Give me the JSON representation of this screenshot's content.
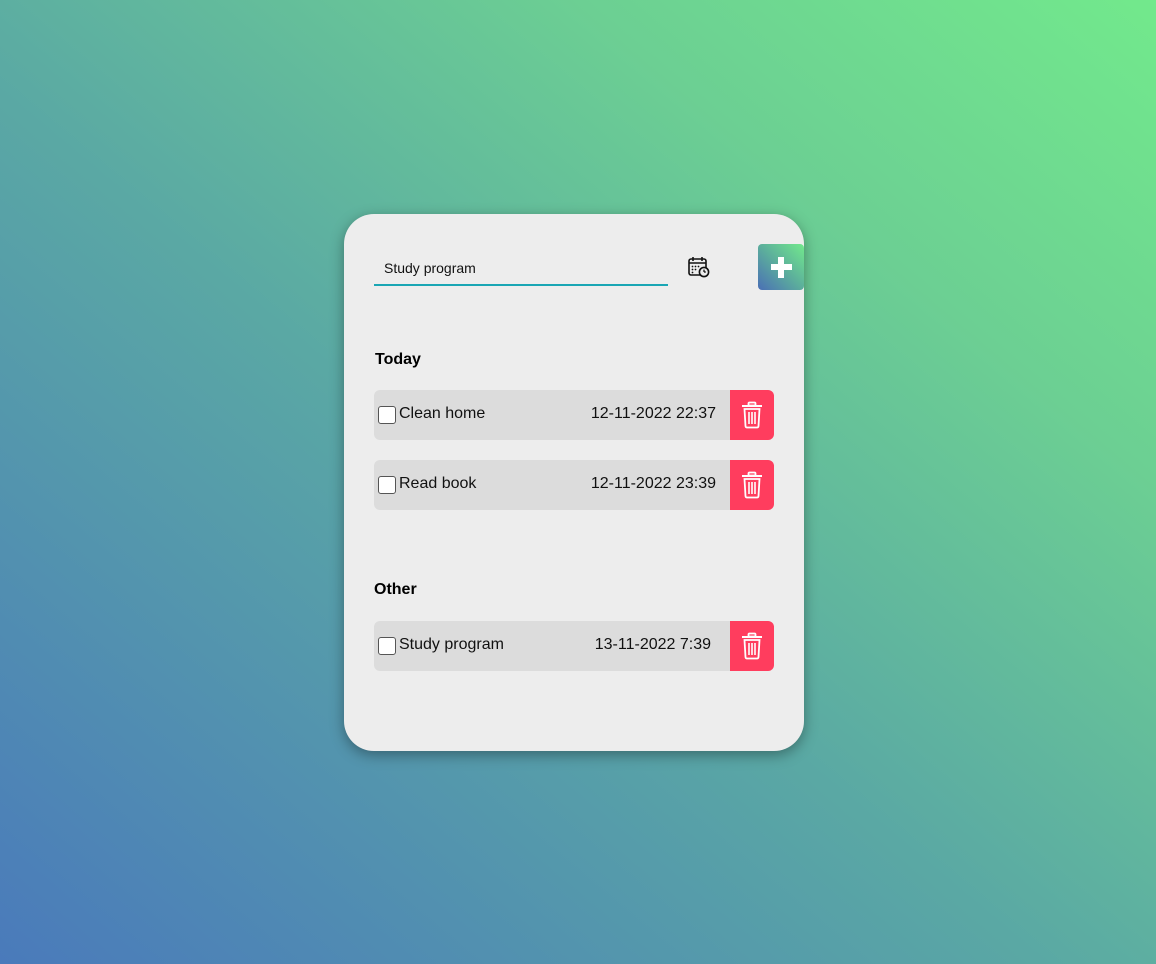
{
  "input": {
    "value": "Study program"
  },
  "icons": {
    "calendar": "calendar-clock-icon",
    "add": "plus-icon",
    "delete": "trash-icon"
  },
  "colors": {
    "delete_bg": "#ff3d5e",
    "input_underline": "#1aa6b4",
    "card_bg": "#ededed",
    "task_bg": "#dcdcdc"
  },
  "sections": [
    {
      "title": "Today",
      "tasks": [
        {
          "name": "Clean home",
          "time": "12-11-2022 22:37",
          "checked": false
        },
        {
          "name": "Read book",
          "time": "12-11-2022 23:39",
          "checked": false
        }
      ]
    },
    {
      "title": "Other",
      "tasks": [
        {
          "name": "Study program",
          "time": "13-11-2022 7:39",
          "checked": false
        }
      ]
    }
  ]
}
